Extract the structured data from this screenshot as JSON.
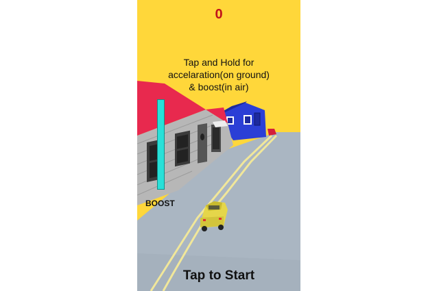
{
  "hud": {
    "score": "0",
    "instructions": [
      "Tap and Hold for",
      "accelaration(on ground)",
      "& boost(in air)"
    ],
    "boost_label": "BOOST",
    "start_prompt": "Tap to Start"
  },
  "boost_meter": {
    "level": 1.0
  },
  "scene": {
    "objects": [
      "road",
      "lane-markings",
      "gray-house",
      "blue-house",
      "red-roof",
      "yellow-pickup-truck"
    ]
  },
  "colors": {
    "sky": "#ffd73a",
    "score": "#c0121a",
    "boost_fill": "#28e0d8",
    "road": "#aab6c2",
    "lane_lines": "#f1e79a",
    "house_gray": "#b7b7b7",
    "house_blue": "#2b3fd6",
    "roof_red": "#e8294e",
    "truck": "#e5d64a"
  }
}
